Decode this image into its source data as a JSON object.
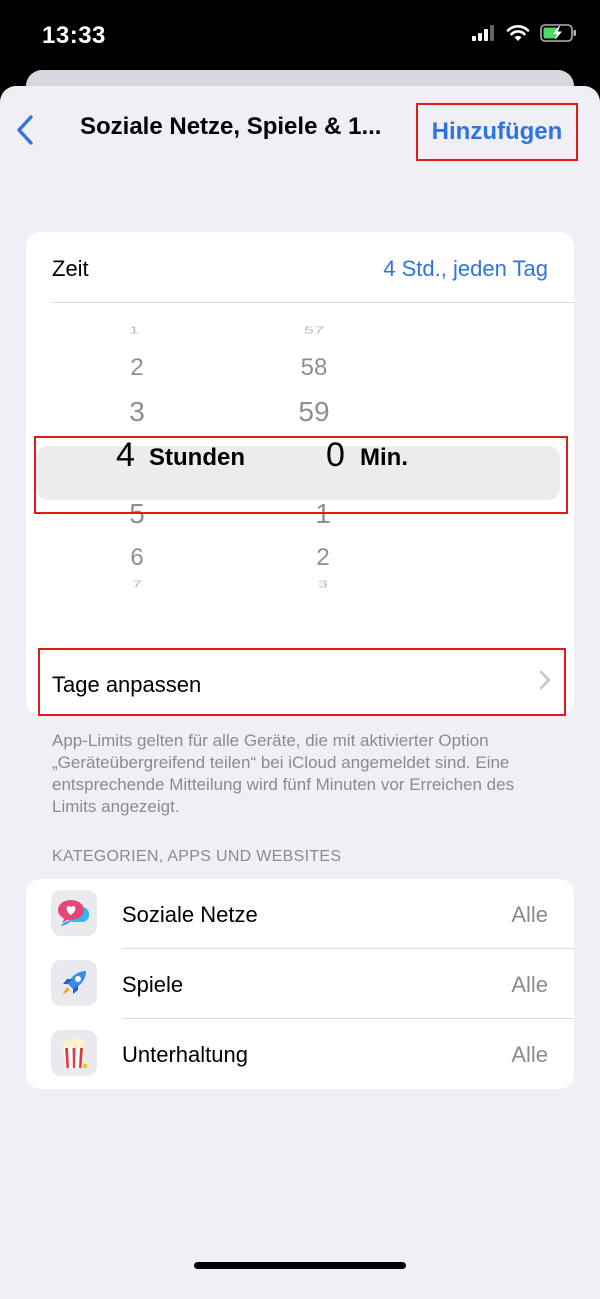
{
  "status": {
    "time": "13:33"
  },
  "nav": {
    "title": "Soziale Netze, Spiele & 1...",
    "add_label": "Hinzufügen"
  },
  "zeit": {
    "label": "Zeit",
    "value": "4 Std., jeden Tag"
  },
  "picker": {
    "hours_above": [
      "1",
      "2",
      "3"
    ],
    "hours_selected": "4",
    "hours_unit": "Stunden",
    "hours_below": [
      "5",
      "6",
      "7"
    ],
    "minutes_above": [
      "57",
      "58",
      "59"
    ],
    "minutes_selected": "0",
    "minutes_unit": "Min.",
    "minutes_below": [
      "1",
      "2",
      "3"
    ]
  },
  "tage": {
    "label": "Tage anpassen"
  },
  "footnote": "App-Limits gelten für alle Geräte, die mit aktivierter Option „Geräteübergreifend teilen“ bei iCloud angemeldet sind. Eine entsprechende Mitteilung wird fünf Minuten vor Erreichen des Limits angezeigt.",
  "section_header": "KATEGORIEN, APPS UND WEBSITES",
  "categories": [
    {
      "name": "Soziale Netze",
      "value": "Alle",
      "icon": "social-chat-heart-icon"
    },
    {
      "name": "Spiele",
      "value": "Alle",
      "icon": "rocket-icon"
    },
    {
      "name": "Unterhaltung",
      "value": "Alle",
      "icon": "popcorn-icon"
    }
  ],
  "colors": {
    "accent": "#2f74e0",
    "highlight": "#e01b1b",
    "background": "#f0eff5"
  }
}
